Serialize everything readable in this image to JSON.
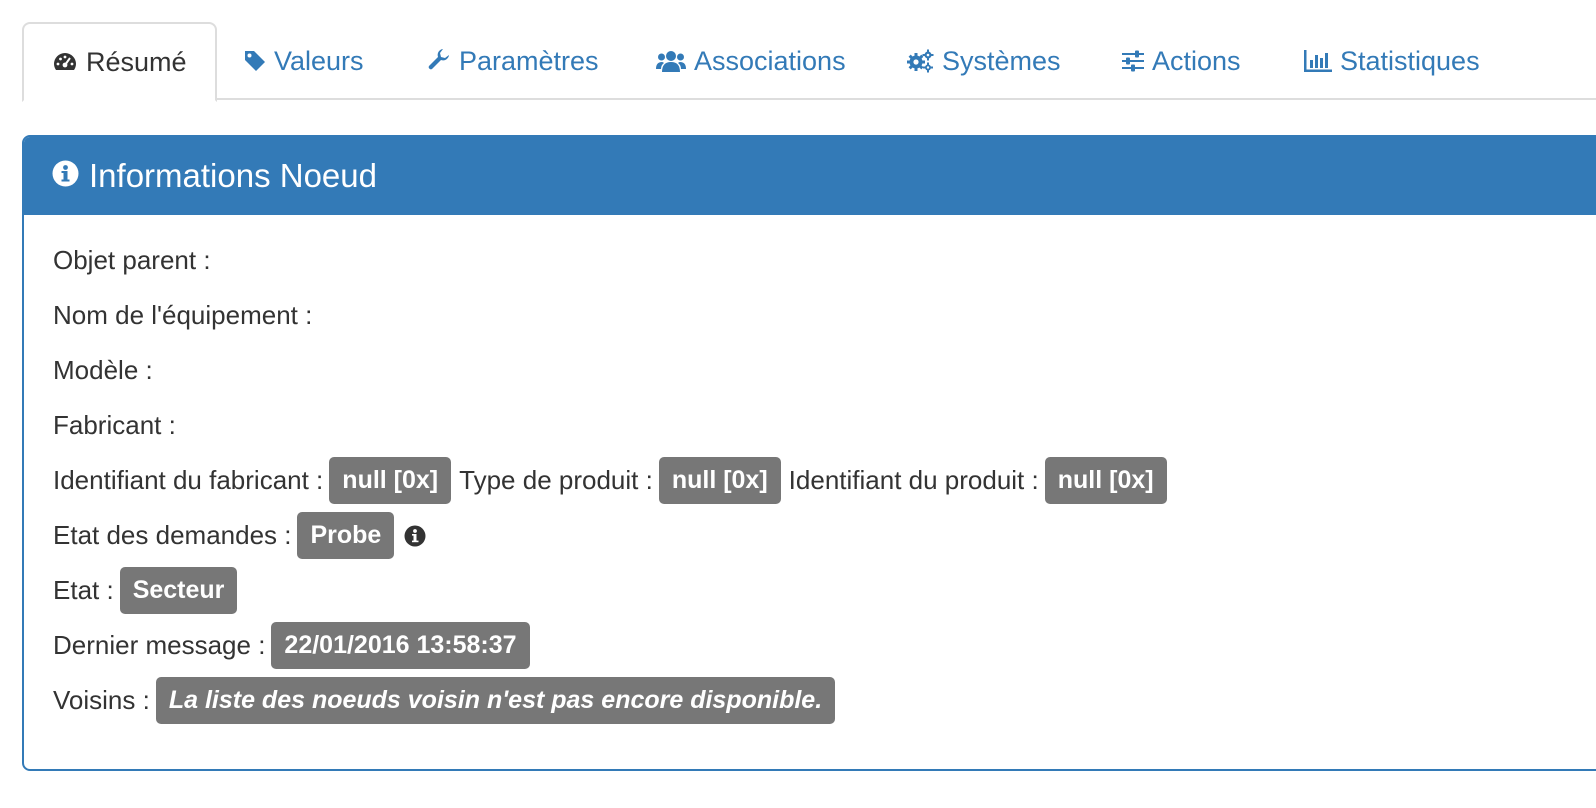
{
  "tabs": [
    {
      "label": "Résumé",
      "icon": "dashboard-icon",
      "active": true
    },
    {
      "label": "Valeurs",
      "icon": "tag-icon"
    },
    {
      "label": "Paramètres",
      "icon": "wrench-icon"
    },
    {
      "label": "Associations",
      "icon": "users-icon"
    },
    {
      "label": "Systèmes",
      "icon": "cogs-icon"
    },
    {
      "label": "Actions",
      "icon": "sliders-icon"
    },
    {
      "label": "Statistiques",
      "icon": "bar-chart-icon"
    }
  ],
  "panel": {
    "title": "Informations Noeud",
    "icon": "info-circle-icon",
    "rows": {
      "parent_object": {
        "label": "Objet parent :"
      },
      "equipment_name": {
        "label": "Nom de l'équipement :"
      },
      "model": {
        "label": "Modèle :"
      },
      "manufacturer": {
        "label": "Fabricant :"
      },
      "manufacturer_id": {
        "label": "Identifiant du fabricant :",
        "value": "null [0x]"
      },
      "product_type": {
        "label": "Type de produit :",
        "value": "null [0x]"
      },
      "product_id": {
        "label": "Identifiant du produit :",
        "value": "null [0x]"
      },
      "requests_state": {
        "label": "Etat des demandes :",
        "value": "Probe"
      },
      "state": {
        "label": "Etat :",
        "value": "Secteur"
      },
      "last_message": {
        "label": "Dernier message :",
        "value": "22/01/2016 13:58:37"
      },
      "neighbors": {
        "label": "Voisins :",
        "value": "La liste des noeuds voisin n'est pas encore disponible."
      }
    }
  },
  "colors": {
    "primary": "#337ab7",
    "badge": "#777777",
    "text": "#333333"
  }
}
